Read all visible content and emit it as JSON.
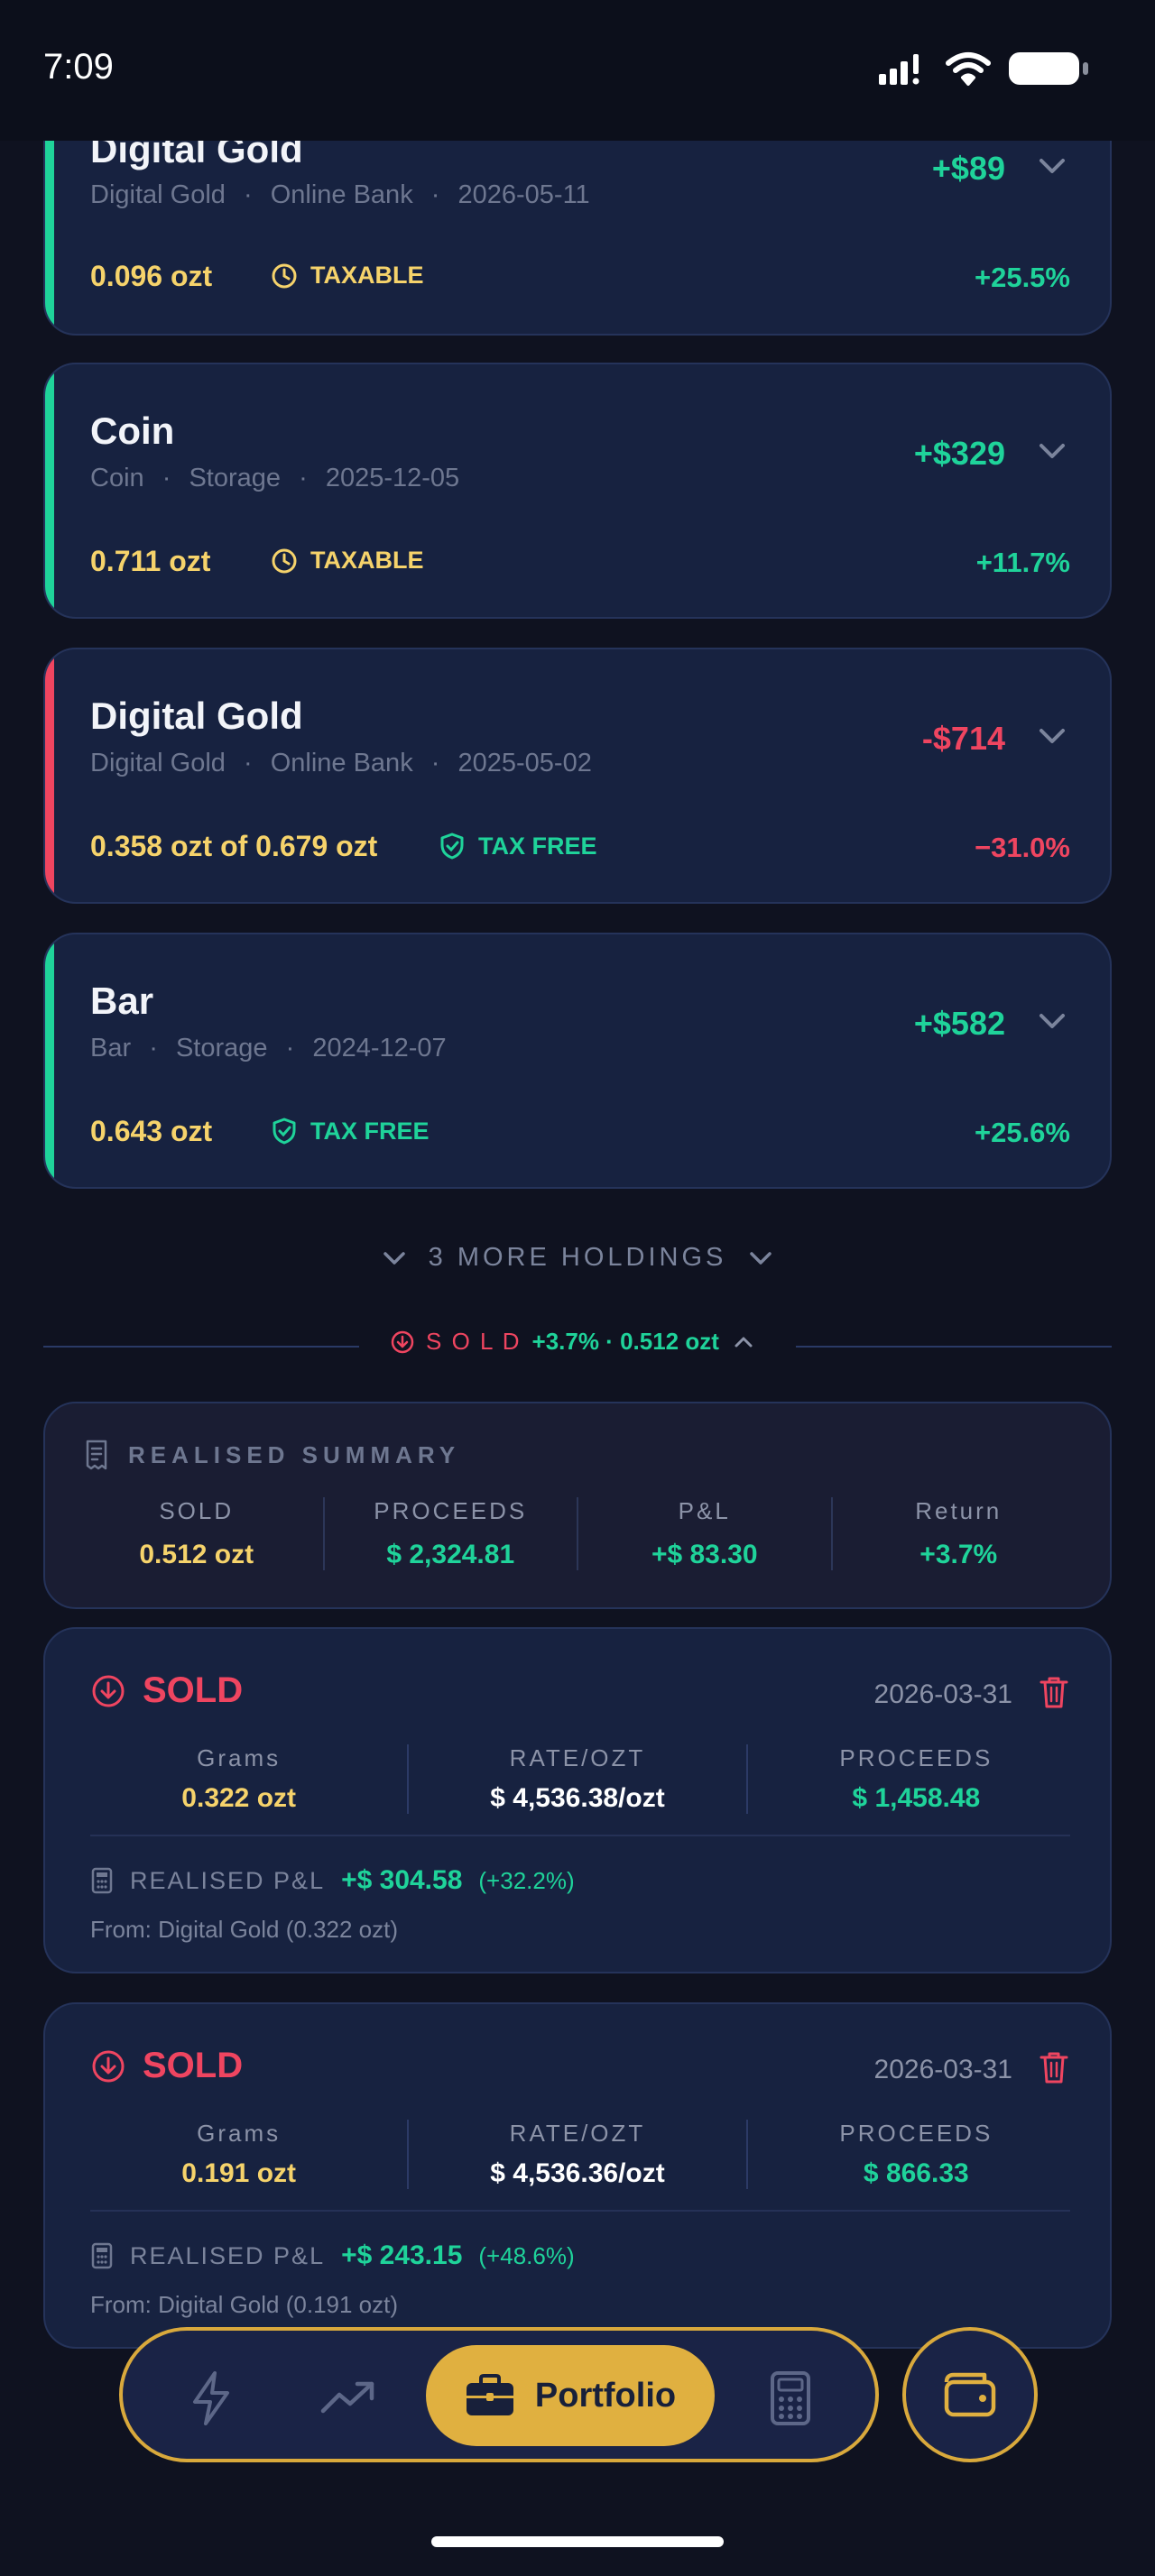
{
  "status": {
    "time": "7:09"
  },
  "holdings": [
    {
      "title": "Digital Gold",
      "type": "Digital Gold",
      "location": "Online Bank",
      "date": "2026-05-11",
      "amount": "+$89",
      "qty": "0.096 ozt",
      "tax": "TAXABLE",
      "pct": "+25.5%"
    },
    {
      "title": "Coin",
      "type": "Coin",
      "location": "Storage",
      "date": "2025-12-05",
      "amount": "+$329",
      "qty": "0.711 ozt",
      "tax": "TAXABLE",
      "pct": "+11.7%"
    },
    {
      "title": "Digital Gold",
      "type": "Digital Gold",
      "location": "Online Bank",
      "date": "2025-05-02",
      "amount": "-$714",
      "qty": "0.358 ozt of 0.679 ozt",
      "tax": "TAX FREE",
      "pct": "−31.0%"
    },
    {
      "title": "Bar",
      "type": "Bar",
      "location": "Storage",
      "date": "2024-12-07",
      "amount": "+$582",
      "qty": "0.643 ozt",
      "tax": "TAX FREE",
      "pct": "+25.6%"
    }
  ],
  "sep": "·",
  "more_holdings": "3 MORE HOLDINGS",
  "sold_section": {
    "label": "S O L D",
    "summary": "+3.7% · 0.512 ozt"
  },
  "realised_summary": {
    "title": "REALISED SUMMARY",
    "cols": [
      {
        "label": "SOLD",
        "value": "0.512 ozt"
      },
      {
        "label": "PROCEEDS",
        "value": "$ 2,324.81"
      },
      {
        "label": "P&L",
        "value": "+$ 83.30"
      },
      {
        "label": "Return",
        "value": "+3.7%"
      }
    ]
  },
  "sold_entries": [
    {
      "label": "SOLD",
      "date": "2026-03-31",
      "grams_label": "Grams",
      "grams": "0.322 ozt",
      "rate_label": "RATE/OZT",
      "rate": "$ 4,536.38/ozt",
      "proceeds_label": "PROCEEDS",
      "proceeds": "$ 1,458.48",
      "pl_label": "REALISED P&L",
      "pl": "+$ 304.58",
      "pl_pct": "(+32.2%)",
      "from": "From: Digital Gold (0.322 ozt)"
    },
    {
      "label": "SOLD",
      "date": "2026-03-31",
      "grams_label": "Grams",
      "grams": "0.191 ozt",
      "rate_label": "RATE/OZT",
      "rate": "$ 4,536.36/ozt",
      "proceeds_label": "PROCEEDS",
      "proceeds": "$ 866.33",
      "pl_label": "REALISED P&L",
      "pl": "+$ 243.15",
      "pl_pct": "(+48.6%)",
      "from": "From: Digital Gold (0.191 ozt)"
    }
  ],
  "nav": {
    "active_label": "Portfolio"
  },
  "colors": {
    "green": "#1fd39a",
    "red": "#ef4560",
    "gold": "#e0b040",
    "yellow": "#f6d36b"
  }
}
